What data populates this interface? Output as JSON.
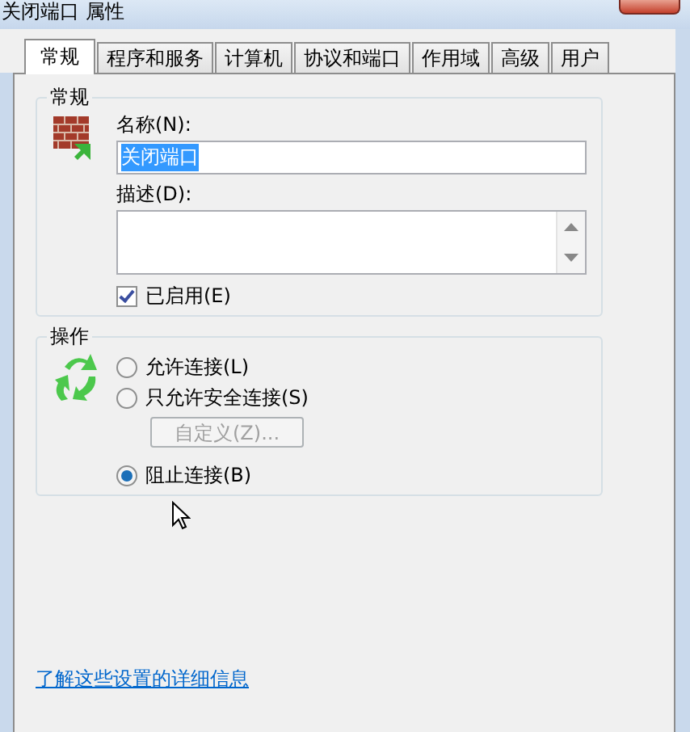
{
  "window": {
    "title": "关闭端口 属性"
  },
  "tabs": [
    {
      "label": "常规",
      "selected": true
    },
    {
      "label": "程序和服务",
      "selected": false
    },
    {
      "label": "计算机",
      "selected": false
    },
    {
      "label": "协议和端口",
      "selected": false
    },
    {
      "label": "作用域",
      "selected": false
    },
    {
      "label": "高级",
      "selected": false
    },
    {
      "label": "用户",
      "selected": false
    }
  ],
  "general": {
    "legend": "常规",
    "name_label": "名称(N):",
    "name_value": "关闭端口",
    "name_selected": true,
    "description_label": "描述(D):",
    "enabled": {
      "label": "已启用(E)",
      "checked": true
    }
  },
  "action": {
    "legend": "操作",
    "options": [
      {
        "label": "允许连接(L)",
        "selected": false
      },
      {
        "label": "只允许安全连接(S)",
        "selected": false
      },
      {
        "label": "阻止连接(B)",
        "selected": true
      }
    ],
    "customize": {
      "label": "自定义(Z)...",
      "disabled": true
    }
  },
  "link": "了解这些设置的详细信息"
}
